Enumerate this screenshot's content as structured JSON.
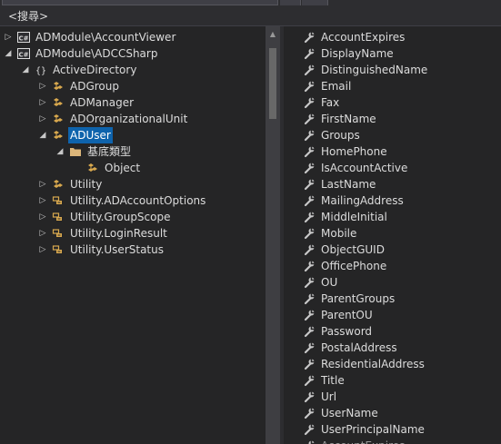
{
  "search": {
    "label": "<搜尋>"
  },
  "tree": [
    {
      "label": "ADModule\\AccountViewer",
      "icon": "csharp-project-icon",
      "arrow": "collapsed",
      "depth": 0,
      "selected": false
    },
    {
      "label": "ADModule\\ADCCSharp",
      "icon": "csharp-project-icon",
      "arrow": "expanded",
      "depth": 0,
      "selected": false
    },
    {
      "label": "ActiveDirectory",
      "icon": "namespace-icon",
      "arrow": "expanded",
      "depth": 1,
      "selected": false
    },
    {
      "label": "ADGroup",
      "icon": "class-icon",
      "arrow": "collapsed",
      "depth": 2,
      "selected": false
    },
    {
      "label": "ADManager",
      "icon": "class-icon",
      "arrow": "collapsed",
      "depth": 2,
      "selected": false
    },
    {
      "label": "ADOrganizationalUnit",
      "icon": "class-icon",
      "arrow": "collapsed",
      "depth": 2,
      "selected": false
    },
    {
      "label": "ADUser",
      "icon": "class-icon",
      "arrow": "expanded",
      "depth": 2,
      "selected": true
    },
    {
      "label": "基底類型",
      "icon": "folder-icon",
      "arrow": "expanded",
      "depth": 3,
      "selected": false
    },
    {
      "label": "Object",
      "icon": "class-icon",
      "arrow": "none",
      "depth": 4,
      "selected": false
    },
    {
      "label": "Utility",
      "icon": "class-icon",
      "arrow": "collapsed",
      "depth": 2,
      "selected": false
    },
    {
      "label": "Utility.ADAccountOptions",
      "icon": "enum-icon",
      "arrow": "collapsed",
      "depth": 2,
      "selected": false
    },
    {
      "label": "Utility.GroupScope",
      "icon": "enum-icon",
      "arrow": "collapsed",
      "depth": 2,
      "selected": false
    },
    {
      "label": "Utility.LoginResult",
      "icon": "enum-icon",
      "arrow": "collapsed",
      "depth": 2,
      "selected": false
    },
    {
      "label": "Utility.UserStatus",
      "icon": "enum-icon",
      "arrow": "collapsed",
      "depth": 2,
      "selected": false
    }
  ],
  "members": [
    "AccountExpires",
    "DisplayName",
    "DistinguishedName",
    "Email",
    "Fax",
    "FirstName",
    "Groups",
    "HomePhone",
    "IsAccountActive",
    "LastName",
    "MailingAddress",
    "MiddleInitial",
    "Mobile",
    "ObjectGUID",
    "OfficePhone",
    "OU",
    "ParentGroups",
    "ParentOU",
    "Password",
    "PostalAddress",
    "ResidentialAddress",
    "Title",
    "Url",
    "UserName",
    "UserPrincipalName",
    "AccountExpires"
  ],
  "member_icon": "wrench-icon",
  "colors": {
    "background": "#252526",
    "selection": "#0e63ac",
    "class_icon": "#d8a84e",
    "text": "#dcdcdc"
  }
}
